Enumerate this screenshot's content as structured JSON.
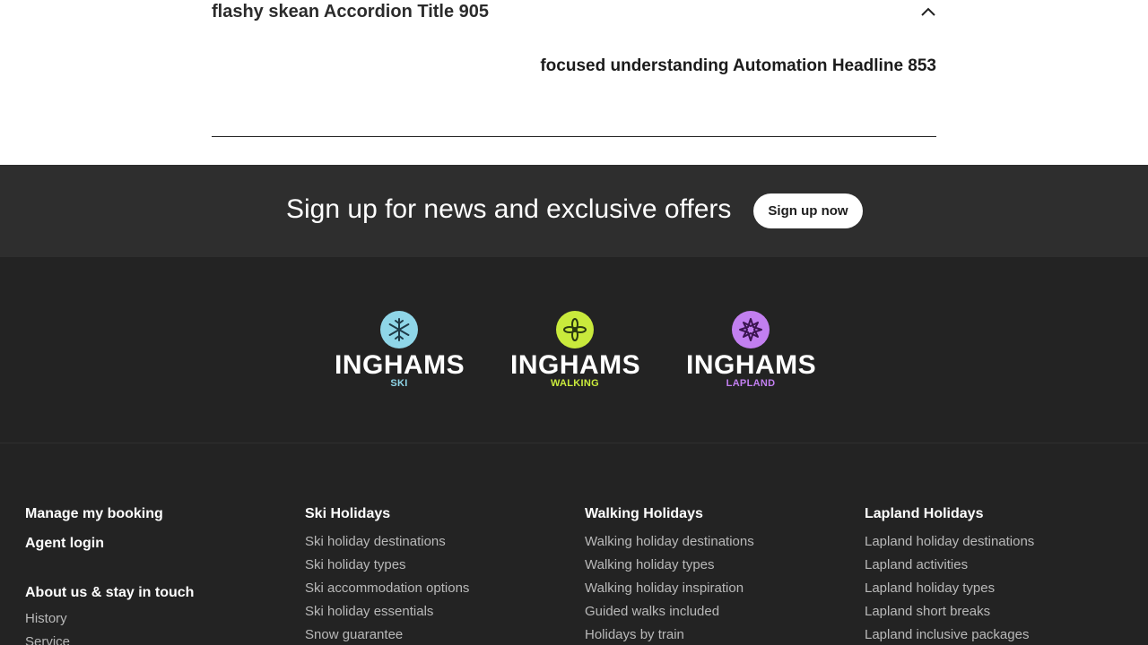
{
  "accordion": {
    "title": "flashy skean Accordion Title 905",
    "headline": "focused understanding Automation Headline 853",
    "chevron_icon": "chevron-up-icon"
  },
  "signup": {
    "text": "Sign up for news and exclusive offers",
    "button_label": "Sign up now"
  },
  "brands": [
    {
      "name": "INGHAMS",
      "sub": "SKI",
      "icon": "snowflake-icon",
      "color": "#8fd6e8",
      "sub_color": "#8fd6e8"
    },
    {
      "name": "INGHAMS",
      "sub": "WALKING",
      "icon": "flower-icon",
      "color": "#c9ea3c",
      "sub_color": "#c9ea3c"
    },
    {
      "name": "INGHAMS",
      "sub": "LAPLAND",
      "icon": "star-flake-icon",
      "color": "#c27ff0",
      "sub_color": "#c27ff0"
    }
  ],
  "footer": {
    "col_a": {
      "manage_booking": "Manage my booking",
      "agent_login": "Agent login",
      "about_heading": "About us & stay in touch",
      "links": [
        "History",
        "Service"
      ]
    },
    "ski": {
      "heading": "Ski Holidays",
      "links": [
        "Ski holiday destinations",
        "Ski holiday types",
        "Ski accommodation options",
        "Ski holiday essentials",
        "Snow guarantee"
      ]
    },
    "walking": {
      "heading": "Walking Holidays",
      "links": [
        "Walking holiday destinations",
        "Walking holiday types",
        "Walking holiday inspiration",
        "Guided walks included",
        "Holidays by train"
      ]
    },
    "lapland": {
      "heading": "Lapland Holidays",
      "links": [
        "Lapland holiday destinations",
        "Lapland activities",
        "Lapland holiday types",
        "Lapland short breaks",
        "Lapland inclusive packages"
      ]
    }
  }
}
